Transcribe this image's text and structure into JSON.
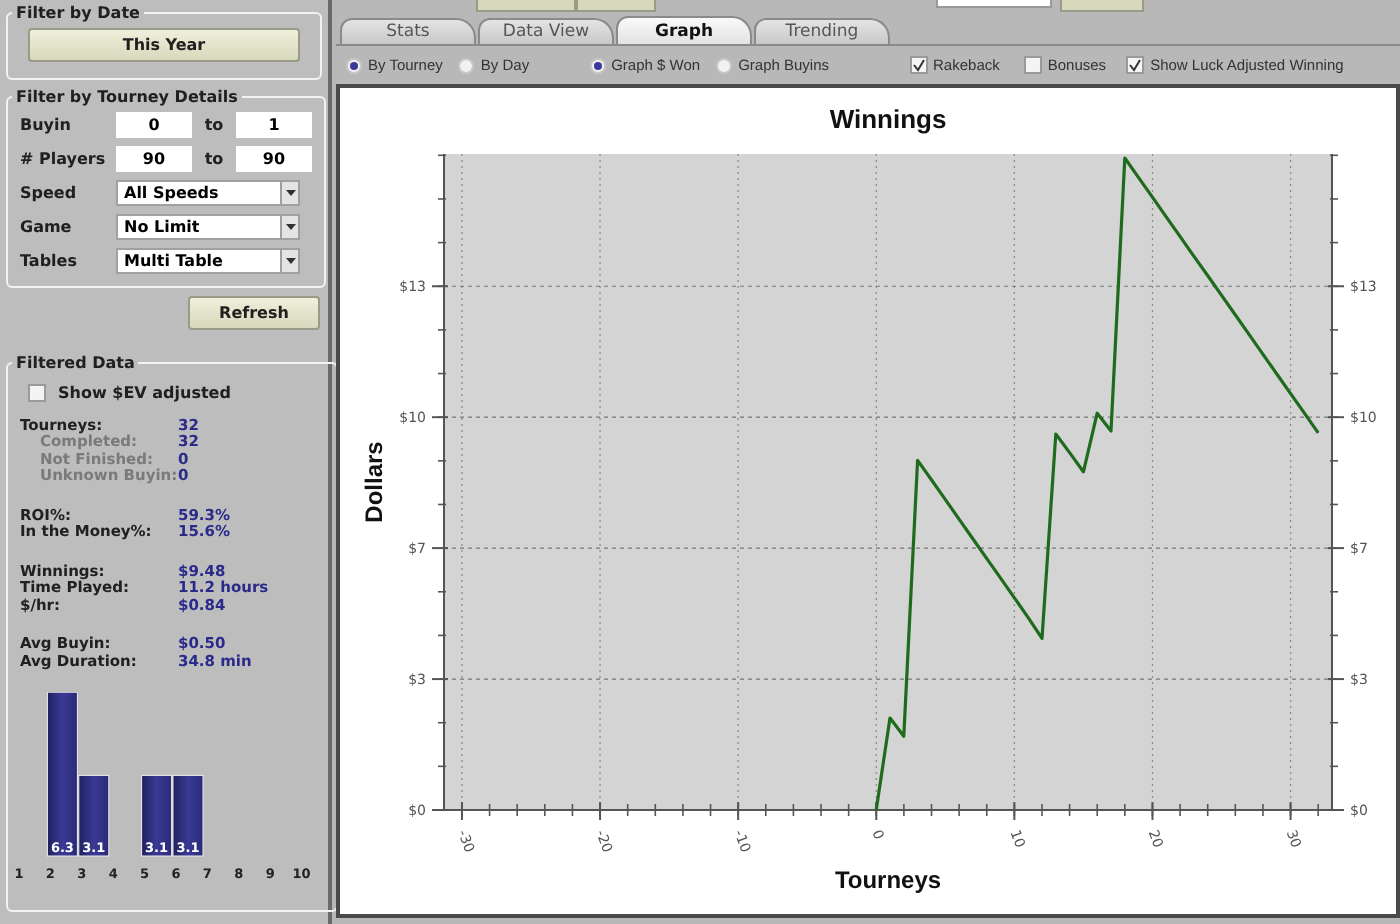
{
  "filter_by_date": {
    "title": "Filter by Date",
    "button": "This Year"
  },
  "filter_by_tourney": {
    "title": "Filter by Tourney Details",
    "ranges": [
      {
        "label": "Buyin",
        "from": "0",
        "to_label": "to",
        "to": "1"
      },
      {
        "label": "# Players",
        "from": "90",
        "to_label": "to",
        "to": "90"
      }
    ],
    "dropdowns": [
      {
        "label": "Speed",
        "value": "All Speeds"
      },
      {
        "label": "Game",
        "value": "No Limit"
      },
      {
        "label": "Tables",
        "value": "Multi Table"
      }
    ]
  },
  "refresh_button": "Refresh",
  "filtered_data": {
    "title": "Filtered Data",
    "ev_checkbox": {
      "label": "Show $EV adjusted",
      "checked": false
    },
    "stat_groups": [
      [
        {
          "label": "Tourneys:",
          "value": "32",
          "kind": "main"
        },
        {
          "label": "Completed:",
          "value": "32",
          "kind": "sub"
        },
        {
          "label": "Not Finished:",
          "value": "0",
          "kind": "sub"
        },
        {
          "label": "Unknown Buyin:",
          "value": "0",
          "kind": "sub"
        }
      ],
      [
        {
          "label": "ROI%:",
          "value": "59.3%",
          "kind": "main"
        },
        {
          "label": "In the Money%:",
          "value": "15.6%",
          "kind": "main"
        }
      ],
      [
        {
          "label": "Winnings:",
          "value": "$9.48",
          "kind": "main"
        },
        {
          "label": "Time Played:",
          "value": "11.2 hours",
          "kind": "main"
        },
        {
          "label": "$/hr:",
          "value": "$0.84",
          "kind": "main"
        }
      ],
      [
        {
          "label": "Avg Buyin:",
          "value": "$0.50",
          "kind": "main"
        },
        {
          "label": "Avg Duration:",
          "value": "34.8 min",
          "kind": "main"
        }
      ]
    ],
    "chart_data": {
      "type": "bar",
      "categories": [
        "1",
        "2",
        "3",
        "4",
        "5",
        "6",
        "7",
        "8",
        "9",
        "10"
      ],
      "values": [
        0,
        6.3,
        3.1,
        0,
        3.1,
        3.1,
        0,
        0,
        0,
        0
      ],
      "value_labels": [
        null,
        "6.3",
        "3.1",
        null,
        "3.1",
        "3.1",
        null,
        null,
        null,
        null
      ]
    }
  },
  "tabs": [
    {
      "label": "Stats",
      "selected": false
    },
    {
      "label": "Data View",
      "selected": false
    },
    {
      "label": "Graph",
      "selected": true
    },
    {
      "label": "Trending",
      "selected": false
    }
  ],
  "options": [
    {
      "kind": "radio",
      "label": "By Tourney",
      "selected": true
    },
    {
      "kind": "radio",
      "label": "By Day",
      "selected": false
    },
    {
      "kind": "radio",
      "label": "Graph $ Won",
      "selected": true
    },
    {
      "kind": "radio",
      "label": "Graph Buyins",
      "selected": false
    },
    {
      "kind": "checkbox",
      "label": "Rakeback",
      "checked": true
    },
    {
      "kind": "checkbox",
      "label": "Bonuses",
      "checked": false
    },
    {
      "kind": "checkbox",
      "label": "Show Luck Adjusted Winning",
      "checked": true
    }
  ],
  "graph": {
    "chart_data": {
      "type": "line",
      "title": "Winnings",
      "xlabel": "Tourneys",
      "ylabel": "Dollars",
      "x": [
        0,
        1,
        2,
        3,
        4,
        5,
        6,
        7,
        8,
        9,
        10,
        11,
        12,
        13,
        14,
        15,
        16,
        17,
        18,
        19,
        20,
        21,
        22,
        23,
        24,
        25,
        26,
        27,
        28,
        29,
        30,
        31,
        32
      ],
      "grid": true,
      "series": [
        {
          "color": "#1e6b1e",
          "values": [
            0,
            2.34,
            1.88,
            8.9,
            8.4,
            7.9,
            7.4,
            6.9,
            6.4,
            5.9,
            5.4,
            4.9,
            4.37,
            9.57,
            9.1,
            8.61,
            10.1,
            9.65,
            16.6,
            16.1,
            15.6,
            15.1,
            14.6,
            14.1,
            13.6,
            13.1,
            12.6,
            12.1,
            11.6,
            11.1,
            10.6,
            10.1,
            9.6
          ]
        }
      ],
      "xlim": [
        -31.3,
        33
      ],
      "ylim": [
        0,
        16.7
      ],
      "xticks": [
        -30,
        -20,
        -10,
        0,
        10,
        20,
        30
      ],
      "yticks": [
        {
          "value": 0,
          "label": "$0"
        },
        {
          "value": 3.333,
          "label": "$3"
        },
        {
          "value": 6.667,
          "label": "$7"
        },
        {
          "value": 10,
          "label": "$10"
        },
        {
          "value": 13.333,
          "label": "$13"
        }
      ]
    }
  }
}
